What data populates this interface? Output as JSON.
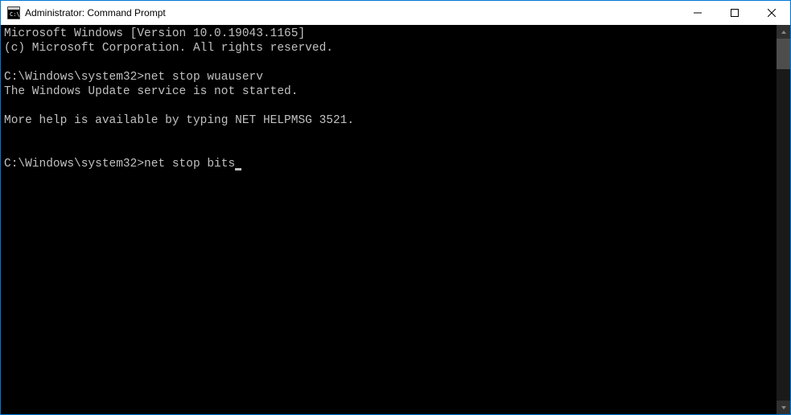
{
  "window": {
    "title": "Administrator: Command Prompt"
  },
  "console": {
    "line1": "Microsoft Windows [Version 10.0.19043.1165]",
    "line2": "(c) Microsoft Corporation. All rights reserved.",
    "prompt1": "C:\\Windows\\system32>",
    "cmd1": "net stop wuauserv",
    "resp1": "The Windows Update service is not started.",
    "resp2": "More help is available by typing NET HELPMSG 3521.",
    "prompt2": "C:\\Windows\\system32>",
    "cmd2": "net stop bits"
  }
}
